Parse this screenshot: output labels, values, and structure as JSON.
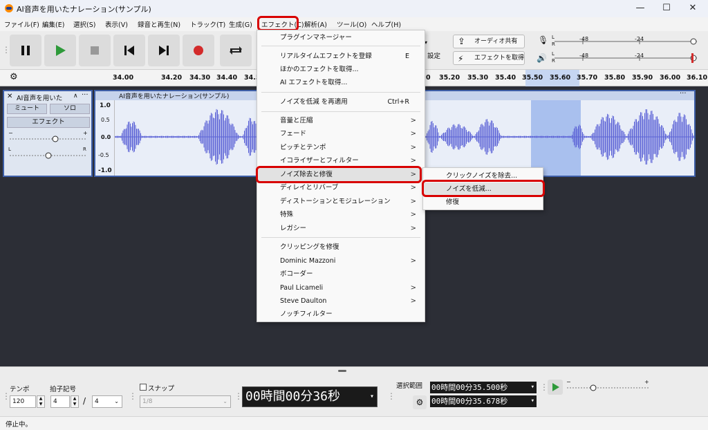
{
  "window": {
    "title": "AI音声を用いたナレーション(サンプル)",
    "minimize": "—",
    "maximize": "☐",
    "close": "✕"
  },
  "menubar": [
    "ファイル(F)",
    "編集(E)",
    "選択(S)",
    "表示(V)",
    "録音と再生(N)",
    "トラック(T)",
    "生成(G)",
    "エフェクト(C)",
    "解析(A)",
    "ツール(O)",
    "ヘルプ(H)"
  ],
  "toolbar": {
    "audio_share": "オーディオ共有",
    "get_effects": "エフェクトを取得",
    "settings_partial": "設定",
    "meter_ticks": [
      "-48",
      "-24",
      "0"
    ],
    "meter_L": "L",
    "meter_R": "R"
  },
  "ruler": {
    "ticks": [
      "34.00",
      "34.20",
      "34.30",
      "34.40",
      "34.5",
      "0",
      "35.20",
      "35.30",
      "35.40",
      "35.50",
      "35.60",
      "35.70",
      "35.80",
      "35.90",
      "36.00",
      "36.10"
    ]
  },
  "track": {
    "name": "AI音声を用いた",
    "mute": "ミュート",
    "solo": "ソロ",
    "effects": "エフェクト",
    "gain_minus": "−",
    "gain_plus": "+",
    "pan_left": "L",
    "pan_right": "R",
    "clip_title": "AI音声を用いたナレーション(サンプル)",
    "y_labels": [
      "1.0",
      "0.5",
      "0.0",
      "-0.5",
      "-1.0"
    ]
  },
  "effects_menu": {
    "items": [
      {
        "label": "プラグインマネージャー"
      },
      {
        "sep": true
      },
      {
        "label": "リアルタイムエフェクトを登録",
        "shortcut": "E"
      },
      {
        "label": "ほかのエフェクトを取得..."
      },
      {
        "label": "AI エフェクトを取得..."
      },
      {
        "sep": true
      },
      {
        "label": "ノイズを低減 を再適用",
        "shortcut": "Ctrl+R"
      },
      {
        "sep": true
      },
      {
        "label": "音量と圧縮",
        "arrow": ">"
      },
      {
        "label": "フェード",
        "arrow": ">"
      },
      {
        "label": "ピッチとテンポ",
        "arrow": ">"
      },
      {
        "label": "イコライザーとフィルター",
        "arrow": ">"
      },
      {
        "label": "ノイズ除去と修復",
        "arrow": ">",
        "highlight": true
      },
      {
        "label": "ディレイとリバーブ",
        "arrow": ">"
      },
      {
        "label": "ディストーションとモジュレーション",
        "arrow": ">"
      },
      {
        "label": "特殊",
        "arrow": ">"
      },
      {
        "label": "レガシー",
        "arrow": ">"
      },
      {
        "sep": true
      },
      {
        "label": "クリッピングを修復"
      },
      {
        "label": "Dominic Mazzoni",
        "arrow": ">"
      },
      {
        "label": "ボコーダー"
      },
      {
        "label": "Paul Licameli",
        "arrow": ">"
      },
      {
        "label": "Steve Daulton",
        "arrow": ">"
      },
      {
        "label": "ノッチフィルター"
      }
    ]
  },
  "noise_submenu": {
    "items": [
      {
        "label": "クリックノイズを除去..."
      },
      {
        "label": "ノイズを低減...",
        "highlight": true
      },
      {
        "label": "修復"
      }
    ]
  },
  "bottom": {
    "tempo_label": "テンポ",
    "tempo_value": "120",
    "time_sig_label": "拍子記号",
    "ts_num": "4",
    "ts_slash": "/",
    "ts_den": "4",
    "snap_label": "スナップ",
    "snap_value": "1/8",
    "time_display": "00時間00分36秒",
    "selection_label": "選択範囲",
    "sel_start": "00時間00分35.500秒",
    "sel_end": "00時間00分35.678秒",
    "speed_minus": "−",
    "speed_plus": "+"
  },
  "status": {
    "text": "停止中。"
  },
  "colors": {
    "accent": "#3e5fa8",
    "waveform": "#5b62d6",
    "selection": "#a9c0ee",
    "red": "#d80000",
    "track_bg": "#2c2e36"
  }
}
